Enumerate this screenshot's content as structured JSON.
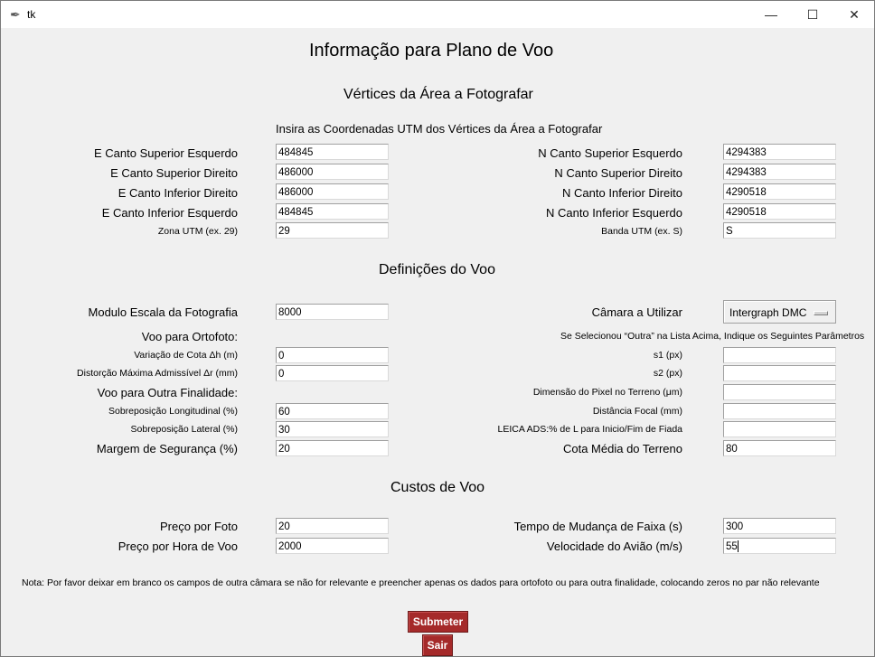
{
  "window": {
    "title": "tk",
    "minimize": "—",
    "maximize": "☐",
    "close": "✕"
  },
  "heading": "Informação para Plano de Voo",
  "vertices": {
    "title": "Vértices da Área a Fotografar",
    "instruction": "Insira as Coordenadas UTM dos Vértices da Área a Fotografar",
    "e_sup_esq_label": "E Canto Superior Esquerdo",
    "e_sup_esq": "484845",
    "e_sup_dir_label": "E Canto Superior Direito",
    "e_sup_dir": "486000",
    "e_inf_dir_label": "E Canto Inferior Direito",
    "e_inf_dir": "486000",
    "e_inf_esq_label": "E Canto Inferior Esquerdo",
    "e_inf_esq": "484845",
    "zona_label": "Zona UTM (ex. 29)",
    "zona": "29",
    "n_sup_esq_label": "N Canto Superior Esquerdo",
    "n_sup_esq": "4294383",
    "n_sup_dir_label": "N Canto Superior Direito",
    "n_sup_dir": "4294383",
    "n_inf_dir_label": "N Canto Inferior Direito",
    "n_inf_dir": "4290518",
    "n_inf_esq_label": "N Canto Inferior Esquerdo",
    "n_inf_esq": "4290518",
    "banda_label": "Banda UTM (ex. S)",
    "banda": "S"
  },
  "definicoes": {
    "title": "Definições do Voo",
    "escala_label": "Modulo Escala da Fotografia",
    "escala": "8000",
    "ortofoto_label": "Voo para Ortofoto:",
    "cota_label": "Variação de Cota Δh (m)",
    "cota": "0",
    "distorcao_label": "Distorção Máxima Admissível Δr (mm)",
    "distorcao": "0",
    "outra_label": "Voo para Outra Finalidade:",
    "sobre_long_label": "Sobreposição Longitudinal (%)",
    "sobre_long": "60",
    "sobre_lat_label": "Sobreposição Lateral (%)",
    "sobre_lat": "30",
    "margem_label": "Margem de Segurança (%)",
    "margem": "20",
    "camara_label": "Câmara a Utilizar",
    "camara": "Intergraph DMC",
    "outra_nota": "Se Selecionou “Outra” na Lista Acima, Indique os Seguintes Parâmetros",
    "s1_label": "s1 (px)",
    "s1": "",
    "s2_label": "s2 (px)",
    "s2": "",
    "pixel_label": "Dimensão do Pixel no Terreno (μm)",
    "pixel": "",
    "focal_label": "Distância Focal (mm)",
    "focal": "",
    "leica_label": "LEICA ADS:% de L para Inicio/Fim de Fiada",
    "leica": "",
    "cota_media_label": "Cota Média do Terreno",
    "cota_media": "80"
  },
  "custos": {
    "title": "Custos de Voo",
    "preco_foto_label": "Preço por Foto",
    "preco_foto": "20",
    "preco_hora_label": "Preço por Hora de Voo",
    "preco_hora": "2000",
    "tempo_faixa_label": "Tempo de Mudança de Faixa (s)",
    "tempo_faixa": "300",
    "velocidade_label": "Velocidade do Avião (m/s)",
    "velocidade": "55"
  },
  "nota": "Nota: Por favor deixar em branco os campos de outra câmara se não for relevante e preencher apenas os dados para ortofoto ou para outra finalidade, colocando zeros no par não relevante",
  "buttons": {
    "submeter": "Submeter",
    "sair": "Sair"
  },
  "colors": {
    "button_bg": "#a52a2a",
    "window_bg": "#f0f0f0"
  }
}
